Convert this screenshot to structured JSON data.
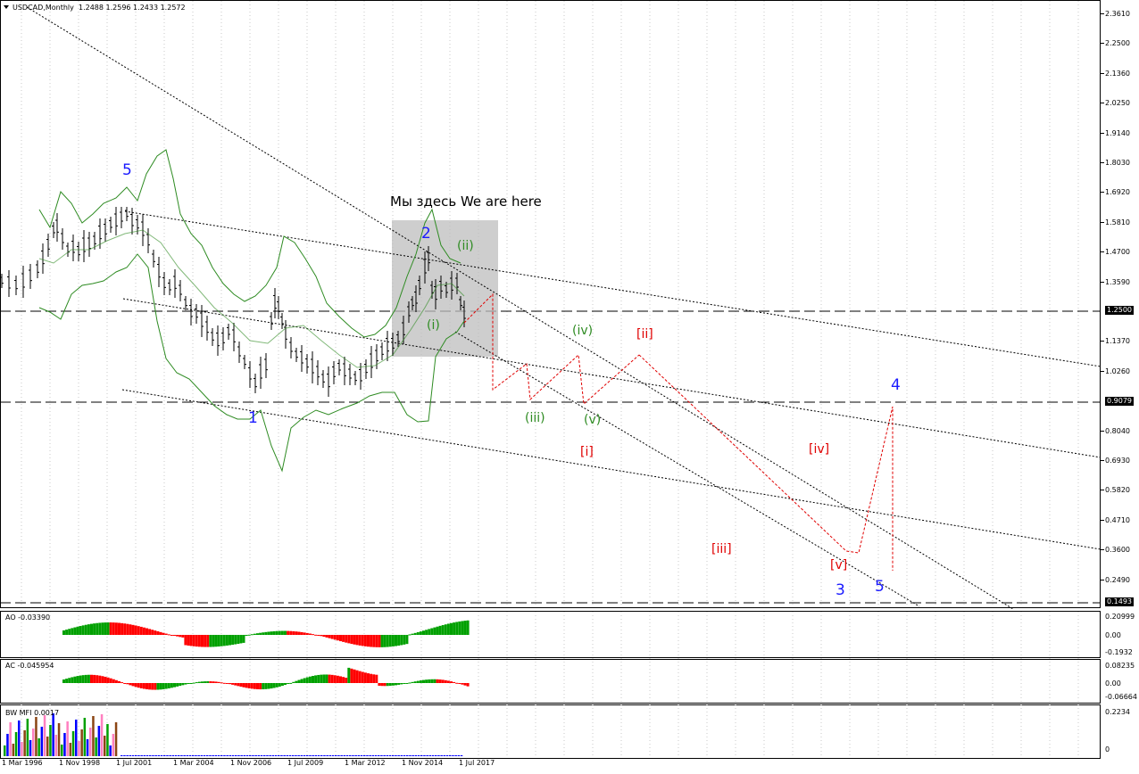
{
  "window": {
    "symbol_caption": "USDCAD,Monthly",
    "ohlc": "1.2488 1.2596 1.2433 1.2572"
  },
  "price_axis": {
    "ticks": [
      "2.3610",
      "2.2500",
      "2.1360",
      "2.0250",
      "1.9140",
      "1.8030",
      "1.6920",
      "1.5810",
      "1.4700",
      "1.3590",
      "1.2500",
      "1.1370",
      "1.0260",
      "0.9079",
      "0.8040",
      "0.6930",
      "0.5820",
      "0.4710",
      "0.3600",
      "0.2490",
      "0.1493"
    ],
    "current_price": "1.2500",
    "hline_level_mid": "0.9079",
    "hline_level_low": "0.1493"
  },
  "indicators": {
    "ao": {
      "label": "AO -0.03390",
      "ticks": [
        "0.20999",
        "0.00",
        "-0.1932"
      ]
    },
    "ac": {
      "label": "AC -0.045954",
      "ticks": [
        "0.08235",
        "0.00",
        "-0.06664"
      ]
    },
    "bw": {
      "label": "BW MFI 0.0017",
      "ticks": [
        "0.2234",
        "0"
      ]
    }
  },
  "time_axis": [
    "1 Mar 1996",
    "1 Nov 1998",
    "1 Jul 2001",
    "1 Mar 2004",
    "1 Nov 2006",
    "1 Jul 2009",
    "1 Mar 2012",
    "1 Nov 2014",
    "1 Jul 2017"
  ],
  "annotations": {
    "note": "Мы здесь We are here",
    "waves": {
      "w5_top": "5",
      "w1": "1",
      "w2": "2",
      "w3": "3",
      "w4": "4",
      "w5_bottom": "5",
      "g_i": "(i)",
      "g_ii": "(ii)",
      "g_iii": "(iii)",
      "g_iv": "(iv)",
      "g_v": "(v)",
      "r_i": "[i]",
      "r_ii": "[ii]",
      "r_iii": "[iii]",
      "r_iv": "[iv]",
      "r_v": "[v]"
    }
  },
  "colors": {
    "bull_bar": "#00a000",
    "bear_bar": "#ff0000",
    "wave_blue": "#1a1aff",
    "wave_green": "#2e8b22",
    "wave_red": "#e00000",
    "band": "#2e8b22"
  }
}
